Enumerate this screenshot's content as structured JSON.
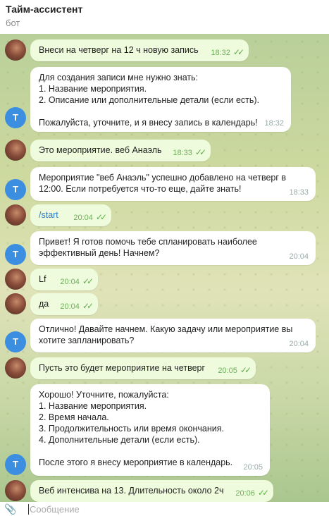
{
  "header": {
    "title": "Тайм-ассистент",
    "subtitle": "бот"
  },
  "bot_avatar_letter": "T",
  "messages": [
    {
      "sender": "user",
      "lines": [
        "Внеси на четверг на 12 ч новую запись"
      ],
      "time": "18:32"
    },
    {
      "sender": "bot",
      "lines": [
        "Для создания записи мне нужно знать:",
        "1. Название мероприятия.",
        "2. Описание или дополнительные детали (если есть).",
        "",
        "Пожалуйста, уточните, и я внесу запись в календарь!"
      ],
      "time": "18:32"
    },
    {
      "sender": "user",
      "lines": [
        "Это мероприятие. веб Анаэль"
      ],
      "time": "18:33"
    },
    {
      "sender": "bot",
      "lines": [
        "Мероприятие \"веб Анаэль\" успешно добавлено на четверг в",
        "12:00. Если потребуется что-то еще, дайте знать!"
      ],
      "time": "18:33"
    },
    {
      "sender": "user",
      "lines": [
        "/start"
      ],
      "time": "20:04",
      "is_command": true
    },
    {
      "sender": "bot",
      "lines": [
        "Привет! Я готов помочь тебе спланировать наиболее",
        "эффективный день! Начнем?"
      ],
      "time": "20:04"
    },
    {
      "sender": "user",
      "lines": [
        "Lf"
      ],
      "time": "20:04"
    },
    {
      "sender": "user",
      "lines": [
        "да"
      ],
      "time": "20:04"
    },
    {
      "sender": "bot",
      "lines": [
        "Отлично! Давайте начнем. Какую задачу или мероприятие вы",
        "хотите запланировать?"
      ],
      "time": "20:04"
    },
    {
      "sender": "user",
      "lines": [
        "Пусть это будет мероприятие на четверг"
      ],
      "time": "20:05"
    },
    {
      "sender": "bot",
      "lines": [
        "Хорошо! Уточните, пожалуйста:",
        "1. Название мероприятия.",
        "2. Время начала.",
        "3. Продолжительность или время окончания.",
        "4. Дополнительные детали (если есть).",
        "",
        "После этого я внесу мероприятие в календарь."
      ],
      "time": "20:05"
    },
    {
      "sender": "user",
      "lines": [
        "Веб интенсива на 13. Длительность около 2ч"
      ],
      "time": "20:06"
    }
  ],
  "input": {
    "placeholder": "Сообщение"
  },
  "colors": {
    "outgoing_bubble": "#eefbdc",
    "incoming_bubble": "#ffffff",
    "bot_avatar": "#3c8fe0",
    "check_marks": "#5cb04a"
  }
}
